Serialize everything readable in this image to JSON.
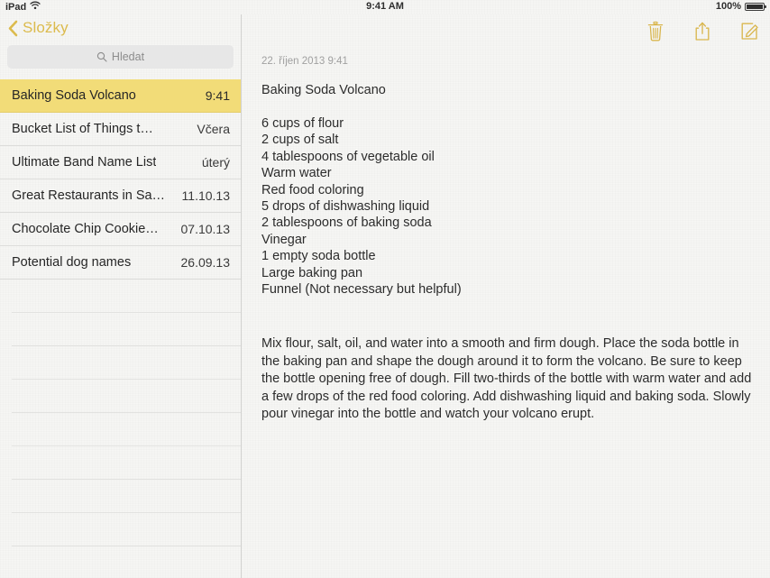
{
  "status_bar": {
    "device_label": "iPad",
    "wifi_icon": "wifi-icon",
    "time": "9:41 AM",
    "battery_percent": "100%",
    "battery_icon": "battery-full-icon"
  },
  "sidebar": {
    "back_button": {
      "icon": "chevron-left-icon",
      "label": "Složky"
    },
    "search": {
      "icon": "search-icon",
      "placeholder": "Hledat",
      "value": ""
    },
    "notes": [
      {
        "title": "Baking Soda Volcano",
        "date": "9:41",
        "selected": true
      },
      {
        "title": "Bucket List of Things t…",
        "date": "Včera",
        "selected": false
      },
      {
        "title": "Ultimate Band Name List",
        "date": "úterý",
        "selected": false
      },
      {
        "title": "Great Restaurants in Sa…",
        "date": "11.10.13",
        "selected": false
      },
      {
        "title": "Chocolate Chip Cookie…",
        "date": "07.10.13",
        "selected": false
      },
      {
        "title": "Potential dog names",
        "date": "26.09.13",
        "selected": false
      }
    ],
    "empty_row_count": 9
  },
  "detail": {
    "toolbar": {
      "delete_icon": "trash-icon",
      "share_icon": "share-icon",
      "compose_icon": "compose-icon"
    },
    "timestamp": "22. říjen 2013 9:41",
    "heading": "Baking Soda Volcano",
    "ingredients": [
      "6 cups of flour",
      "2 cups of salt",
      "4 tablespoons of vegetable oil",
      "Warm water",
      "Red food coloring",
      "5 drops of dishwashing liquid",
      "2 tablespoons of baking soda",
      "Vinegar",
      "1 empty soda bottle",
      "Large baking pan",
      "Funnel (Not necessary but helpful)"
    ],
    "instructions": "Mix flour, salt, oil, and water into a smooth and firm dough.  Place the soda bottle in the baking pan and shape the dough around it to form the volcano.  Be sure to keep the bottle opening free of dough.  Fill two-thirds of the bottle with warm water and add a few drops of the red food coloring. Add dishwashing liquid and baking soda. Slowly pour vinegar into the bottle and watch your volcano erupt."
  },
  "colors": {
    "accent": "#dcbb4d",
    "selected_row": "#f2dc78",
    "paper": "#f6f6f4",
    "text": "#2c2c2c",
    "muted_text": "#a0a0a0"
  }
}
